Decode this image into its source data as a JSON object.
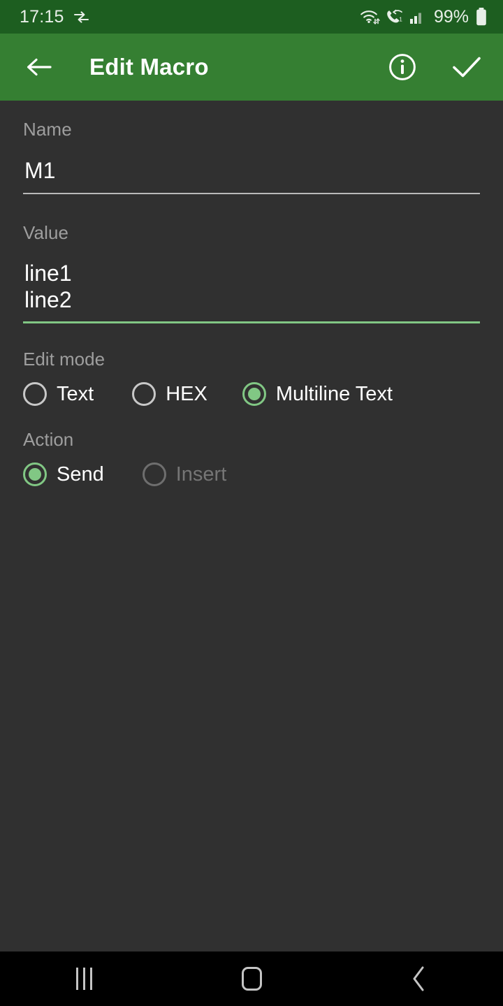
{
  "status_bar": {
    "clock": "17:15",
    "battery_percent": "99%",
    "icons": {
      "data_transfer": "data-transfer-icon",
      "wifi": "wifi-icon",
      "call": "missed-call-icon",
      "signal": "cellular-signal-icon",
      "battery": "battery-icon"
    },
    "colors": {
      "background": "#1d5e20",
      "foreground": "#e8efe8"
    }
  },
  "app_bar": {
    "title": "Edit Macro",
    "back_icon": "back-arrow-icon",
    "info_icon": "info-icon",
    "confirm_icon": "checkmark-icon",
    "colors": {
      "background": "#357f32",
      "foreground": "#ffffff"
    }
  },
  "form": {
    "name_field": {
      "label": "Name",
      "value": "M1",
      "placeholder": "",
      "focused": false
    },
    "value_field": {
      "label": "Value",
      "value": "line1\nline2",
      "placeholder": "",
      "focused": true
    },
    "edit_mode": {
      "label": "Edit mode",
      "selected": "Multiline Text",
      "options": [
        {
          "label": "Text",
          "selected": false,
          "disabled": false
        },
        {
          "label": "HEX",
          "selected": false,
          "disabled": false
        },
        {
          "label": "Multiline Text",
          "selected": true,
          "disabled": false
        }
      ]
    },
    "action": {
      "label": "Action",
      "selected": "Send",
      "options": [
        {
          "label": "Send",
          "selected": true,
          "disabled": false
        },
        {
          "label": "Insert",
          "selected": false,
          "disabled": true
        }
      ]
    }
  },
  "nav_bar": {
    "recents_label": "recents-icon",
    "home_label": "home-icon",
    "back_label": "back-icon"
  },
  "colors": {
    "accent_green": "#81c784",
    "app_bar_green": "#357f32",
    "status_bar_green": "#1d5e20",
    "background": "#303030",
    "label_gray": "#9e9e9e",
    "disabled_gray": "#757575"
  }
}
